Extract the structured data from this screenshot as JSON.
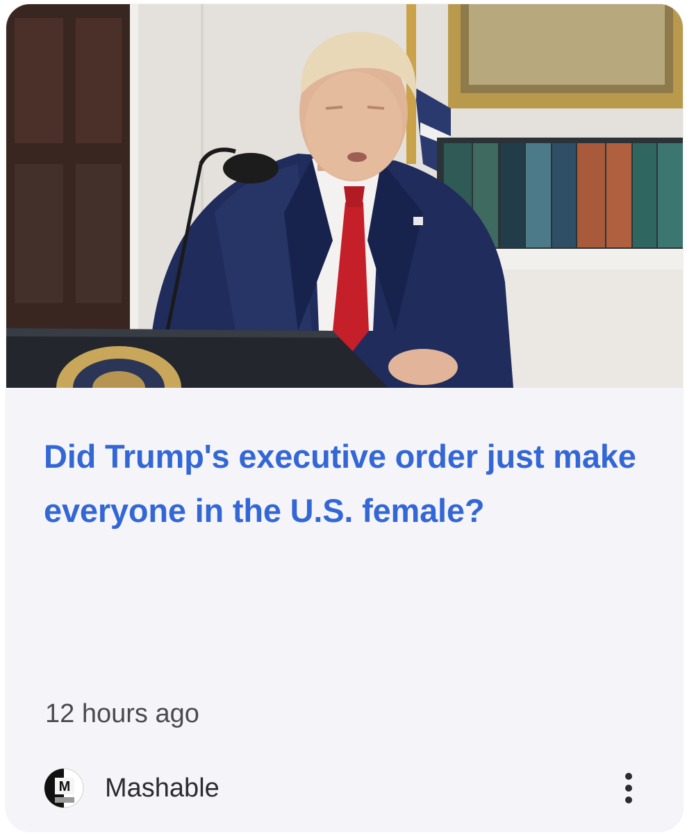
{
  "card": {
    "image_alt": "Man in navy suit and red tie speaking at a presidential podium",
    "headline": "Did Trump's executive order just make everyone in the U.S. female?",
    "time_ago": "12 hours ago",
    "source": {
      "logo_letter": "M",
      "name": "Mashable"
    },
    "more_icon": "more-vertical-icon"
  },
  "colors": {
    "headline": "#3367d6",
    "card_background": "#f5f5f9",
    "meta_text": "#4a4a4f"
  }
}
